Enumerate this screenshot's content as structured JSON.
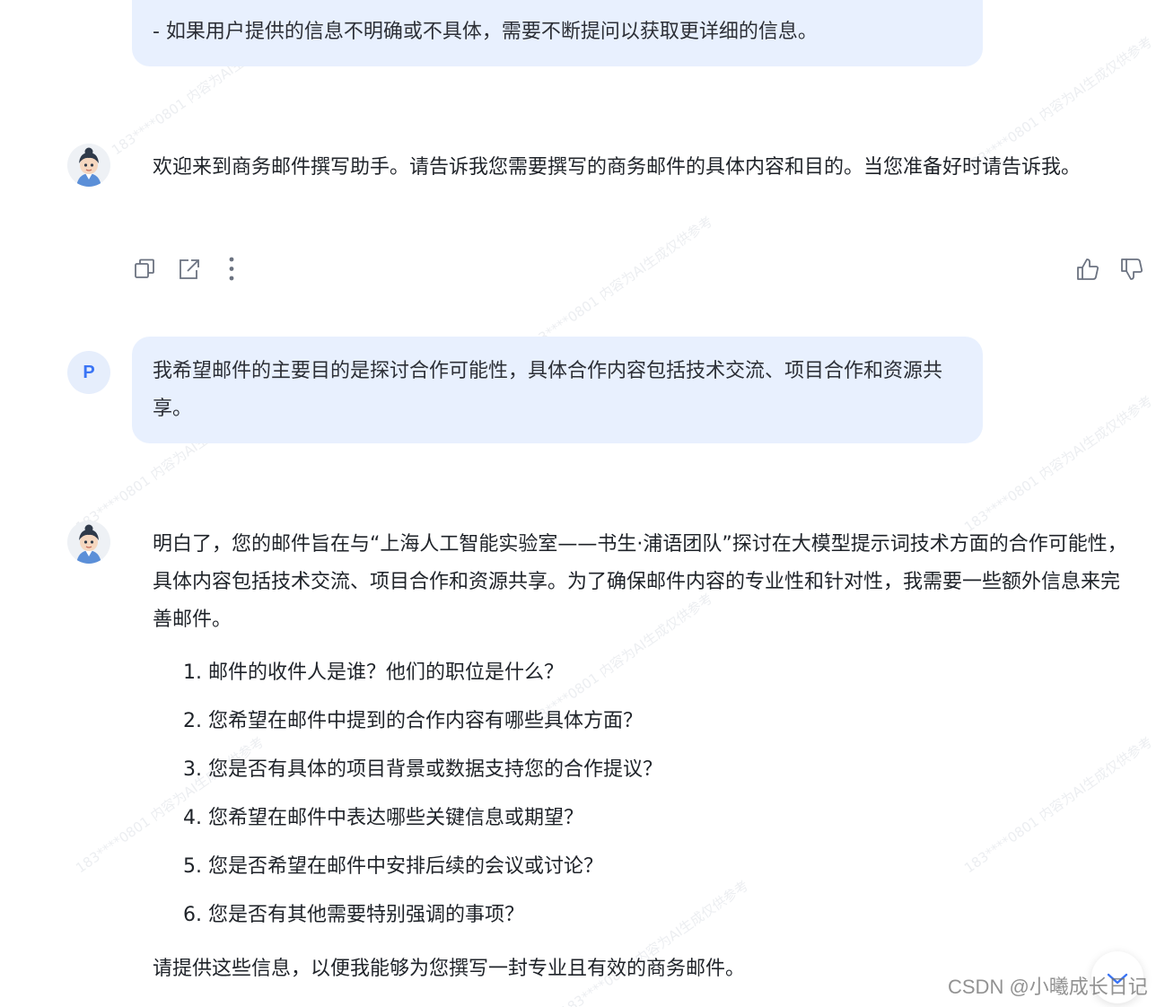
{
  "conversation": {
    "top_bubble_text": "- 如果用户提供的信息不明确或不具体，需要不断提问以获取更详细的信息。",
    "assistant_message_1": "欢迎来到商务邮件撰写助手。请告诉我您需要撰写的商务邮件的具体内容和目的。当您准备好时请告诉我。",
    "user_avatar_letter": "P",
    "user_message": "我希望邮件的主要目的是探讨合作可能性，具体合作内容包括技术交流、项目合作和资源共享。",
    "assistant_message_2_intro": "明白了，您的邮件旨在与“上海人工智能实验室——书生·浦语团队”探讨在大模型提示词技术方面的合作可能性，具体内容包括技术交流、项目合作和资源共享。为了确保邮件内容的专业性和针对性，我需要一些额外信息来完善邮件。",
    "questions": [
      "1. 邮件的收件人是谁？他们的职位是什么？",
      "2. 您希望在邮件中提到的合作内容有哪些具体方面？",
      "3. 您是否有具体的项目背景或数据支持您的合作提议？",
      "4. 您希望在邮件中表达哪些关键信息或期望？",
      "5. 您是否希望在邮件中安排后续的会议或讨论？",
      "6. 您是否有其他需要特别强调的事项？"
    ],
    "assistant_message_2_closing": "请提供这些信息，以便我能够为您撰写一封专业且有效的商务邮件。"
  },
  "actions": {
    "icons": [
      "copy-icon",
      "share-icon",
      "more-icon",
      "thumbs-up-icon",
      "thumbs-down-icon"
    ]
  },
  "watermark": {
    "text": "183****0801 内容为AI生成仅供参考"
  },
  "footer": {
    "csdn_watermark": "CSDN @小曦成长日记"
  },
  "colors": {
    "bubble_bg": "#e8f0fe",
    "user_avatar_bg": "#e6eefc",
    "user_avatar_fg": "#3a74f5",
    "icon_color": "#6b7280"
  }
}
